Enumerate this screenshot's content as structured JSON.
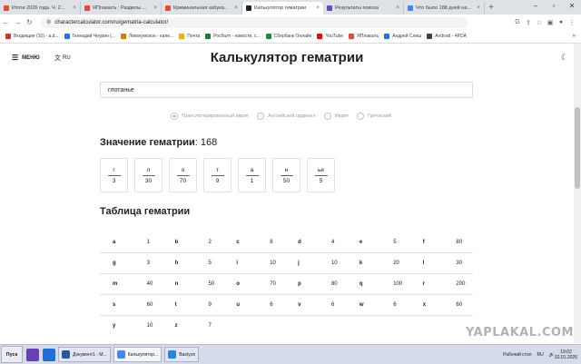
{
  "browser": {
    "tabs": [
      {
        "title": "Итоги 2026 года. Ч. 2...",
        "color": "#e8492f",
        "active": false
      },
      {
        "title": "ЯПлакалъ : Разделы ...",
        "color": "#e8492f",
        "active": false
      },
      {
        "title": "Криминальная азбука...",
        "color": "#e8492f",
        "active": false
      },
      {
        "title": "Калькулятор гематрии",
        "color": "#202124",
        "active": true
      },
      {
        "title": "Результаты поиска",
        "color": "#5b4fcf",
        "active": false
      },
      {
        "title": "Что было 188 дней на...",
        "color": "#4285f4",
        "active": false
      }
    ],
    "url": "charactercalculator.com/ru/gematria-calculator/",
    "bookmarks": [
      {
        "label": "Входящие (10) - a.d...",
        "color": "#d93025"
      },
      {
        "label": "Геннадий Чеурин (...",
        "color": "#1a73e8"
      },
      {
        "label": "Левокумское - кале...",
        "color": "#e37400"
      },
      {
        "label": "Почта",
        "color": "#f9ab00"
      },
      {
        "label": "Росбалт - новости, с...",
        "color": "#188038"
      },
      {
        "label": "Сбербанк Онлайн",
        "color": "#1e8e3e"
      },
      {
        "label": "YouTube",
        "color": "#ff0000"
      },
      {
        "label": "ЯПлакалъ",
        "color": "#e8492f"
      },
      {
        "label": "Андрей Слиш",
        "color": "#1a73e8"
      },
      {
        "label": "Android - 4PDA",
        "color": "#3c4043"
      }
    ]
  },
  "site": {
    "menu_label": "МЕНЮ",
    "lang_label": "RU",
    "title": "Калькулятор гематрии",
    "input_value": "глотанье",
    "options": [
      {
        "label": "Транслитерированный иврит",
        "selected": true
      },
      {
        "label": "Английский ординал",
        "selected": false
      },
      {
        "label": "Иврит",
        "selected": false
      },
      {
        "label": "Греческий",
        "selected": false
      }
    ],
    "value_label": "Значение гематрии",
    "value_number": ": 168",
    "letters": [
      {
        "ch": "г",
        "n": "3"
      },
      {
        "ch": "л",
        "n": "30"
      },
      {
        "ch": "о",
        "n": "70"
      },
      {
        "ch": "т",
        "n": "9"
      },
      {
        "ch": "а",
        "n": "1"
      },
      {
        "ch": "н",
        "n": "50"
      },
      {
        "ch": "ье",
        "n": "5"
      }
    ],
    "table_title": "Таблица гематрии",
    "table_rows": [
      [
        [
          "a",
          "1"
        ],
        [
          "b",
          "2"
        ],
        [
          "c",
          "8"
        ],
        [
          "d",
          "4"
        ],
        [
          "e",
          "5"
        ],
        [
          "f",
          "80"
        ]
      ],
      [
        [
          "g",
          "3"
        ],
        [
          "h",
          "5"
        ],
        [
          "i",
          "10"
        ],
        [
          "j",
          "10"
        ],
        [
          "k",
          "20"
        ],
        [
          "l",
          "30"
        ]
      ],
      [
        [
          "m",
          "40"
        ],
        [
          "n",
          "50"
        ],
        [
          "o",
          "70"
        ],
        [
          "p",
          "80"
        ],
        [
          "q",
          "100"
        ],
        [
          "r",
          "200"
        ]
      ],
      [
        [
          "s",
          "60"
        ],
        [
          "t",
          "9"
        ],
        [
          "u",
          "6"
        ],
        [
          "v",
          "6"
        ],
        [
          "w",
          "6"
        ],
        [
          "x",
          "60"
        ]
      ],
      [
        [
          "y",
          "10"
        ],
        [
          "z",
          "7"
        ]
      ]
    ]
  },
  "watermark": "YAPLAKAL.COM",
  "taskbar": {
    "start_label": "Пуск",
    "apps": [
      {
        "label": "Документ1 - М...",
        "color": "#2b579a",
        "active": false
      },
      {
        "label": "Калькулятор...",
        "color": "#4285f4",
        "active": true
      },
      {
        "label": "Bastyon",
        "color": "#1e88e5",
        "active": false
      }
    ],
    "desktop_label": "Рабочий стол",
    "layout": "RU",
    "time": "19:02",
    "date": "02.01.2026"
  }
}
